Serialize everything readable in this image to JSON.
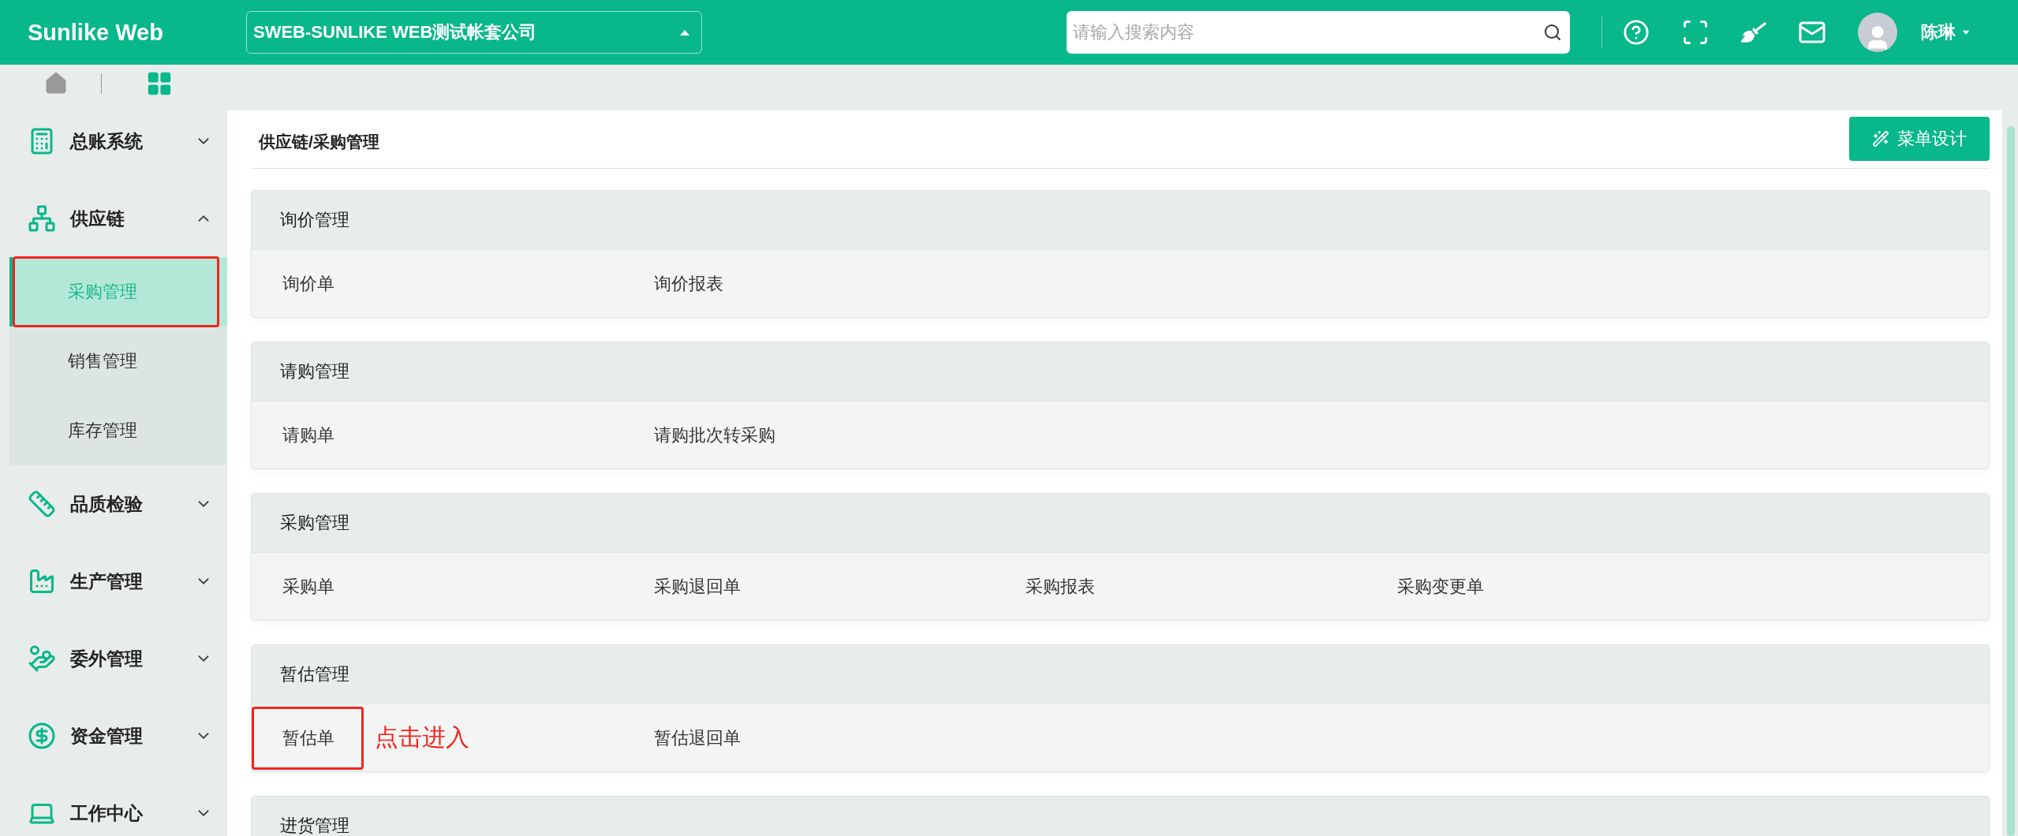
{
  "header": {
    "logo": "Sunlike Web",
    "company": "SWEB-SUNLIKE WEB测试帐套公司",
    "search": {
      "placeholder": "请输入搜索内容"
    },
    "user": "陈琳"
  },
  "sidebar": {
    "items": [
      {
        "label": "总账系统",
        "expanded": false
      },
      {
        "label": "供应链",
        "expanded": true,
        "children": [
          {
            "label": "采购管理",
            "selected": true,
            "highlighted": true
          },
          {
            "label": "销售管理",
            "selected": false,
            "highlighted": false
          },
          {
            "label": "库存管理",
            "selected": false,
            "highlighted": false
          }
        ]
      },
      {
        "label": "品质检验",
        "expanded": false
      },
      {
        "label": "生产管理",
        "expanded": false
      },
      {
        "label": "委外管理",
        "expanded": false
      },
      {
        "label": "资金管理",
        "expanded": false
      },
      {
        "label": "工作中心",
        "expanded": false
      }
    ]
  },
  "breadcrumb": "供应链/采购管理",
  "design_button": "菜单设计",
  "sections": [
    {
      "title": "询价管理",
      "links": [
        {
          "label": "询价单",
          "highlighted": false
        },
        {
          "label": "询价报表",
          "highlighted": false
        }
      ]
    },
    {
      "title": "请购管理",
      "links": [
        {
          "label": "请购单",
          "highlighted": false
        },
        {
          "label": "请购批次转采购",
          "highlighted": false
        }
      ]
    },
    {
      "title": "采购管理",
      "links": [
        {
          "label": "采购单",
          "highlighted": false
        },
        {
          "label": "采购退回单",
          "highlighted": false
        },
        {
          "label": "采购报表",
          "highlighted": false
        },
        {
          "label": "采购变更单",
          "highlighted": false
        }
      ]
    },
    {
      "title": "暂估管理",
      "links": [
        {
          "label": "暂估单",
          "highlighted": true,
          "callout": "点击进入"
        },
        {
          "label": "暂估退回单",
          "highlighted": false
        }
      ]
    },
    {
      "title": "进货管理"
    }
  ]
}
